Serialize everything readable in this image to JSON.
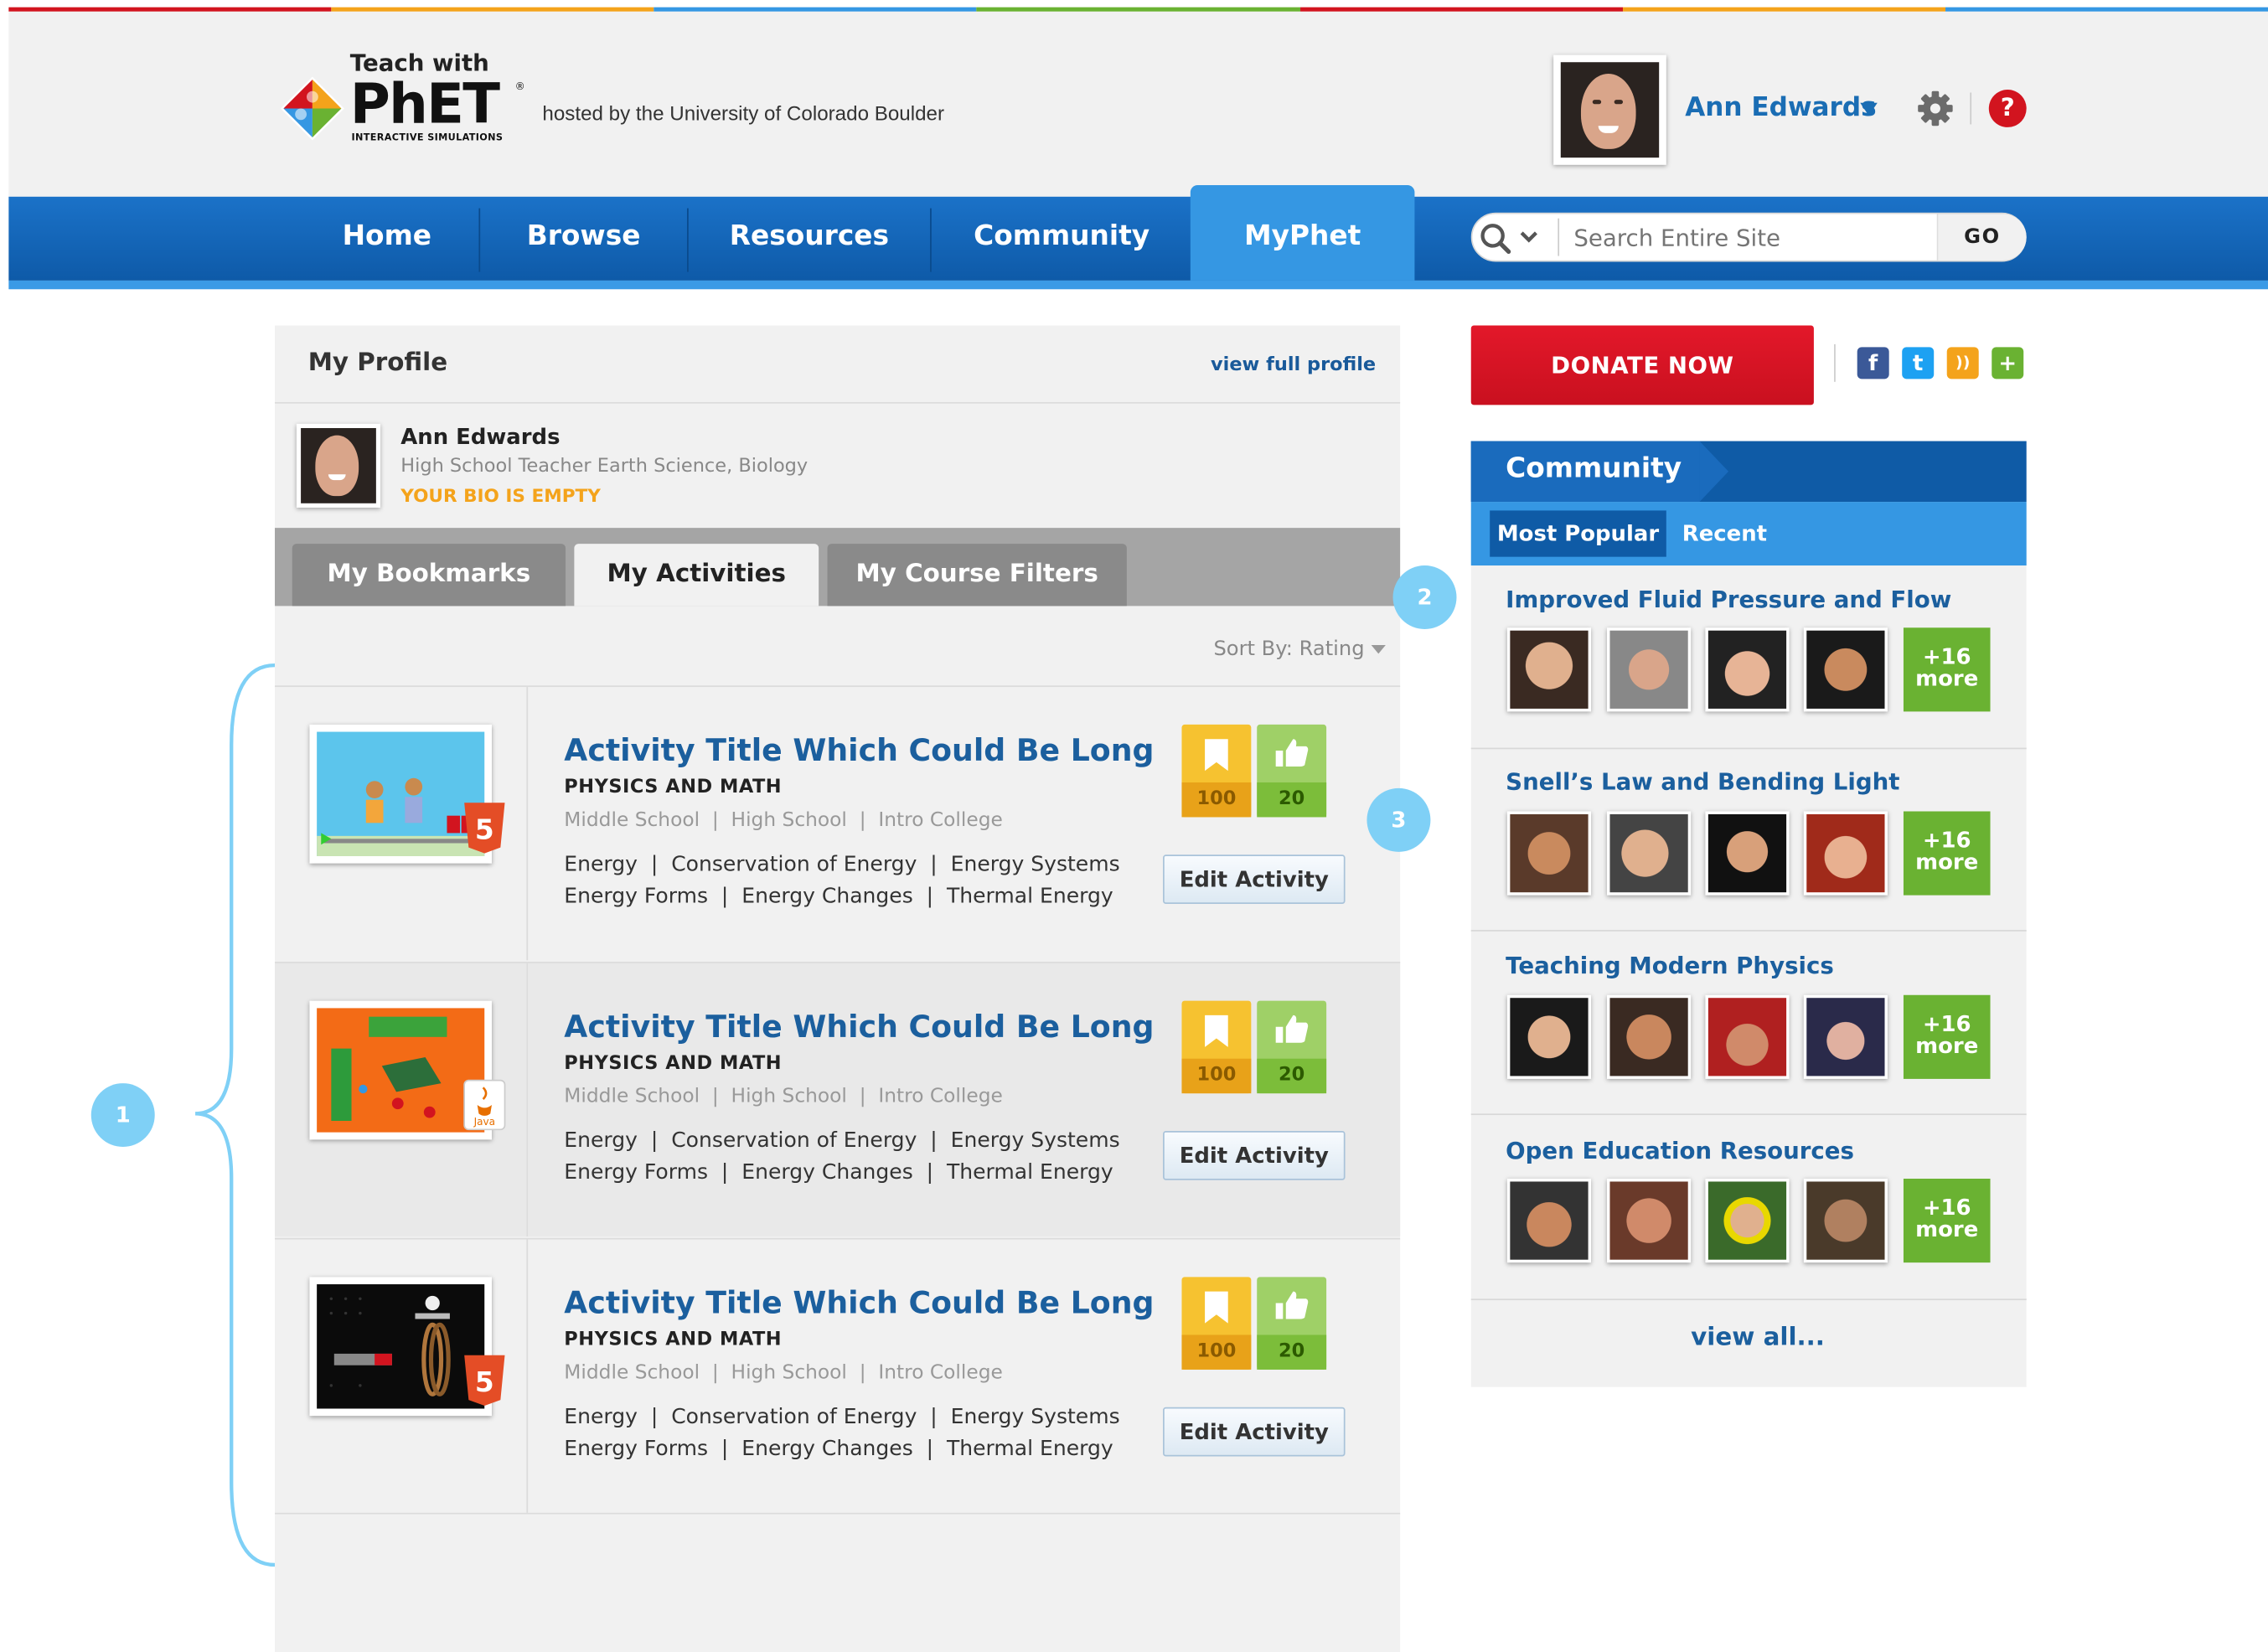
{
  "brand": {
    "teach_with": "Teach with",
    "name": "PhET",
    "tm": "®",
    "subtitle": "INTERACTIVE SIMULATIONS",
    "hosted_by": "hosted by the University of Colorado Boulder",
    "stripe_colors": [
      "#d2141f",
      "#f4a31b",
      "#3597e3",
      "#6ab232",
      "#d2141f",
      "#f4a31b",
      "#3597e3"
    ]
  },
  "user": {
    "name": "Ann Edwards",
    "dropdown_icon": "caret-down-icon"
  },
  "nav": {
    "items": [
      "Home",
      "Browse",
      "Resources",
      "Community",
      "MyPhet"
    ],
    "active": "MyPhet"
  },
  "search": {
    "placeholder": "Search Entire Site",
    "go_label": "GO"
  },
  "profile": {
    "title": "My Profile",
    "view_full_profile": "view full profile",
    "name": "Ann Edwards",
    "role": "High School Teacher Earth Science, Biology",
    "bio_notice": "YOUR BIO IS EMPTY"
  },
  "tabs": {
    "items": [
      "My Bookmarks",
      "My Activities",
      "My Course Filters"
    ],
    "active": "My Activities"
  },
  "sort": {
    "label": "Sort By: Rating"
  },
  "activities": [
    {
      "title": "Activity Title Which Could Be Long",
      "subject": "PHYSICS AND MATH",
      "levels": "Middle School  |  High School  |  Intro College",
      "tags_line1": "Energy  |  Conservation of Energy  |  Energy Systems",
      "tags_line2": "Energy Forms  |  Energy Changes  |  Thermal Energy",
      "bookmarks": "100",
      "likes": "20",
      "edit_label": "Edit Activity",
      "format": "html5",
      "format_label": "5"
    },
    {
      "title": "Activity Title Which Could Be Long",
      "subject": "PHYSICS AND MATH",
      "levels": "Middle School  |  High School  |  Intro College",
      "tags_line1": "Energy  |  Conservation of Energy  |  Energy Systems",
      "tags_line2": "Energy Forms  |  Energy Changes  |  Thermal Energy",
      "bookmarks": "100",
      "likes": "20",
      "edit_label": "Edit Activity",
      "format": "java",
      "format_label": "Java"
    },
    {
      "title": "Activity Title Which Could Be Long",
      "subject": "PHYSICS AND MATH",
      "levels": "Middle School  |  High School  |  Intro College",
      "tags_line1": "Energy  |  Conservation of Energy  |  Energy Systems",
      "tags_line2": "Energy Forms  |  Energy Changes  |  Thermal Energy",
      "bookmarks": "100",
      "likes": "20",
      "edit_label": "Edit Activity",
      "format": "html5",
      "format_label": "5"
    }
  ],
  "donate": {
    "label": "DONATE NOW"
  },
  "social": [
    "facebook-icon",
    "twitter-icon",
    "rss-icon",
    "puzzle-icon"
  ],
  "social_glyphs": [
    "f",
    "t",
    "))",
    "+"
  ],
  "community": {
    "title": "Community",
    "tabs": [
      "Most Popular",
      "Recent"
    ],
    "active_tab": "Most Popular",
    "groups": [
      {
        "title": "Improved Fluid Pressure and Flow",
        "more_count": "+16",
        "more_word": "more"
      },
      {
        "title": "Snell’s Law and Bending Light",
        "more_count": "+16",
        "more_word": "more"
      },
      {
        "title": "Teaching Modern Physics",
        "more_count": "+16",
        "more_word": "more"
      },
      {
        "title": "Open Education Resources",
        "more_count": "+16",
        "more_word": "more"
      }
    ],
    "view_all": "view all..."
  },
  "annotations": [
    "1",
    "2",
    "3"
  ],
  "colors": {
    "nav_blue": "#1b72c8",
    "nav_active": "#3597e3",
    "link_blue": "#1b5f9e",
    "donate_red": "#d2141f",
    "bookmark_yellow": "#f6c230",
    "like_green": "#9fd067",
    "more_green": "#6ab232",
    "annotation_blue": "#7fd0f6"
  }
}
